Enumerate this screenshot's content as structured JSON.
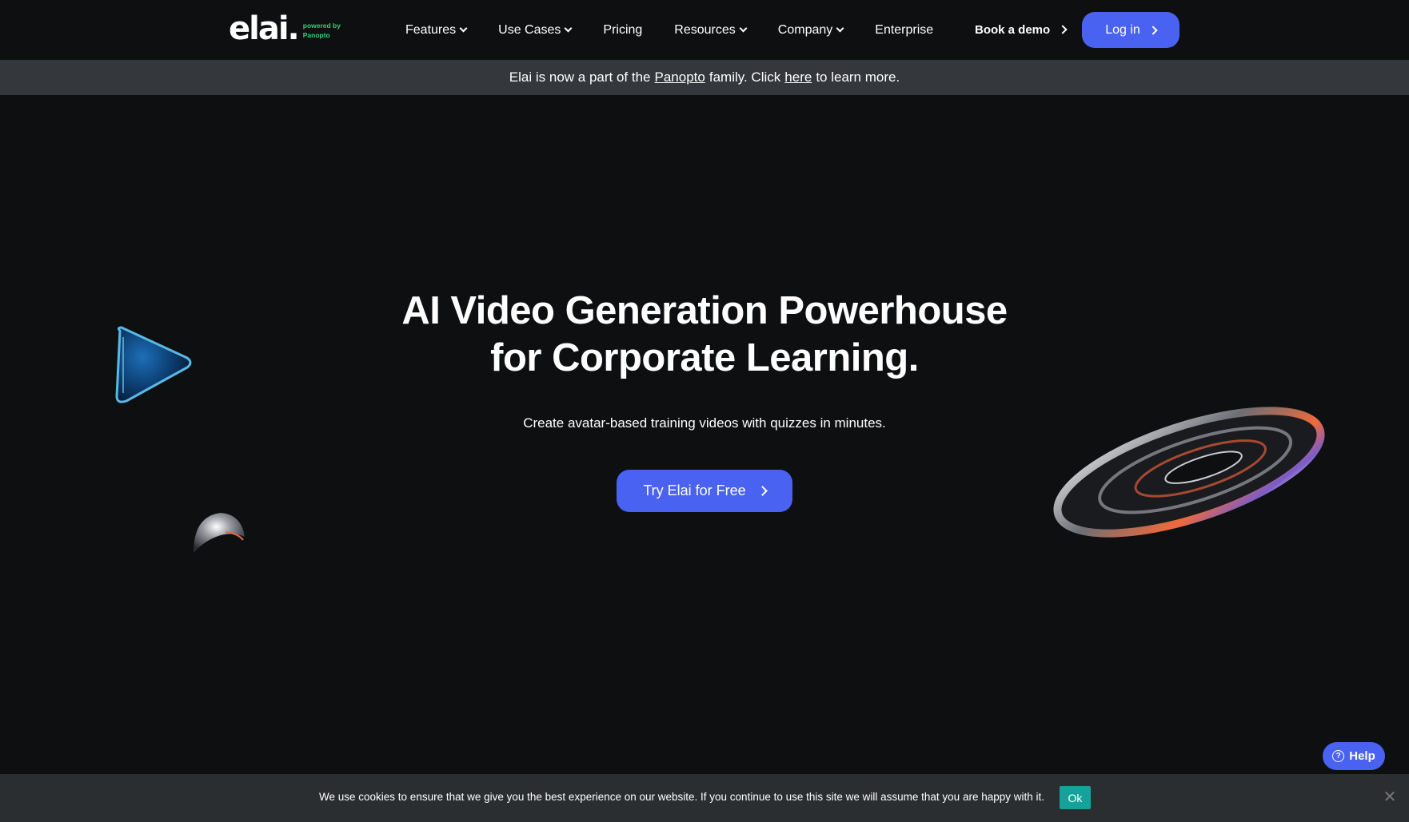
{
  "logo": {
    "wordmark": "elai.",
    "powered_by_line1": "powered by",
    "powered_by_line2": "Panopto"
  },
  "nav": {
    "items": [
      {
        "label": "Features",
        "dropdown": true
      },
      {
        "label": "Use Cases",
        "dropdown": true
      },
      {
        "label": "Pricing",
        "dropdown": false
      },
      {
        "label": "Resources",
        "dropdown": true
      },
      {
        "label": "Company",
        "dropdown": true
      },
      {
        "label": "Enterprise",
        "dropdown": false
      }
    ],
    "book_demo": "Book a demo",
    "login": "Log in"
  },
  "banner": {
    "text_1": "Elai is now a part of the",
    "link_1": "Panopto",
    "text_2": "family. Click",
    "link_2": "here",
    "text_3": "to learn more."
  },
  "hero": {
    "title_line1": "AI Video Generation Powerhouse",
    "title_line2": "for Corporate Learning.",
    "subtitle": "Create avatar-based training videos with quizzes in minutes.",
    "cta": "Try Elai for Free"
  },
  "help": {
    "label": "Help",
    "icon_glyph": "?"
  },
  "cookie": {
    "text": "We use cookies to ensure that we give you the best experience on our website. If you continue to use this site we will assume that you are happy with it.",
    "ok": "Ok",
    "close_glyph": "✕"
  },
  "colors": {
    "background": "#0d0f10",
    "accent": "#4a62f2",
    "banner_bg": "#34373b",
    "cookie_bg": "#2b2e31",
    "ok_bg": "#14a39a",
    "powered_by": "#33d17a"
  }
}
